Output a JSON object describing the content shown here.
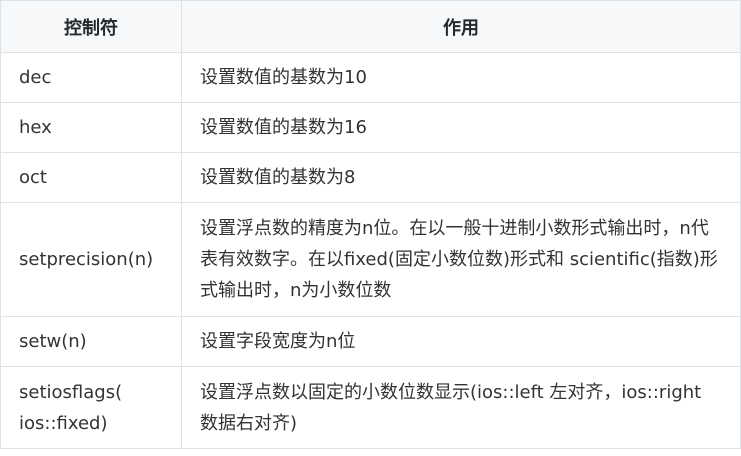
{
  "table": {
    "headers": [
      "控制符",
      "作用"
    ],
    "rows": [
      [
        "dec",
        "设置数值的基数为10"
      ],
      [
        "hex",
        "设置数值的基数为16"
      ],
      [
        "oct",
        "设置数值的基数为8"
      ],
      [
        "setprecision(n)",
        "设置浮点数的精度为n位。在以一般十进制小数形式输出时，n代表有效数字。在以fixed(固定小数位数)形式和 scientific(指数)形式输出时，n为小数位数"
      ],
      [
        "setw(n)",
        "设置字段宽度为n位"
      ],
      [
        "setiosflags( ios::fixed)",
        "设置浮点数以固定的小数位数显示(ios::left 左对齐，ios::right 数据右对齐)"
      ]
    ]
  }
}
